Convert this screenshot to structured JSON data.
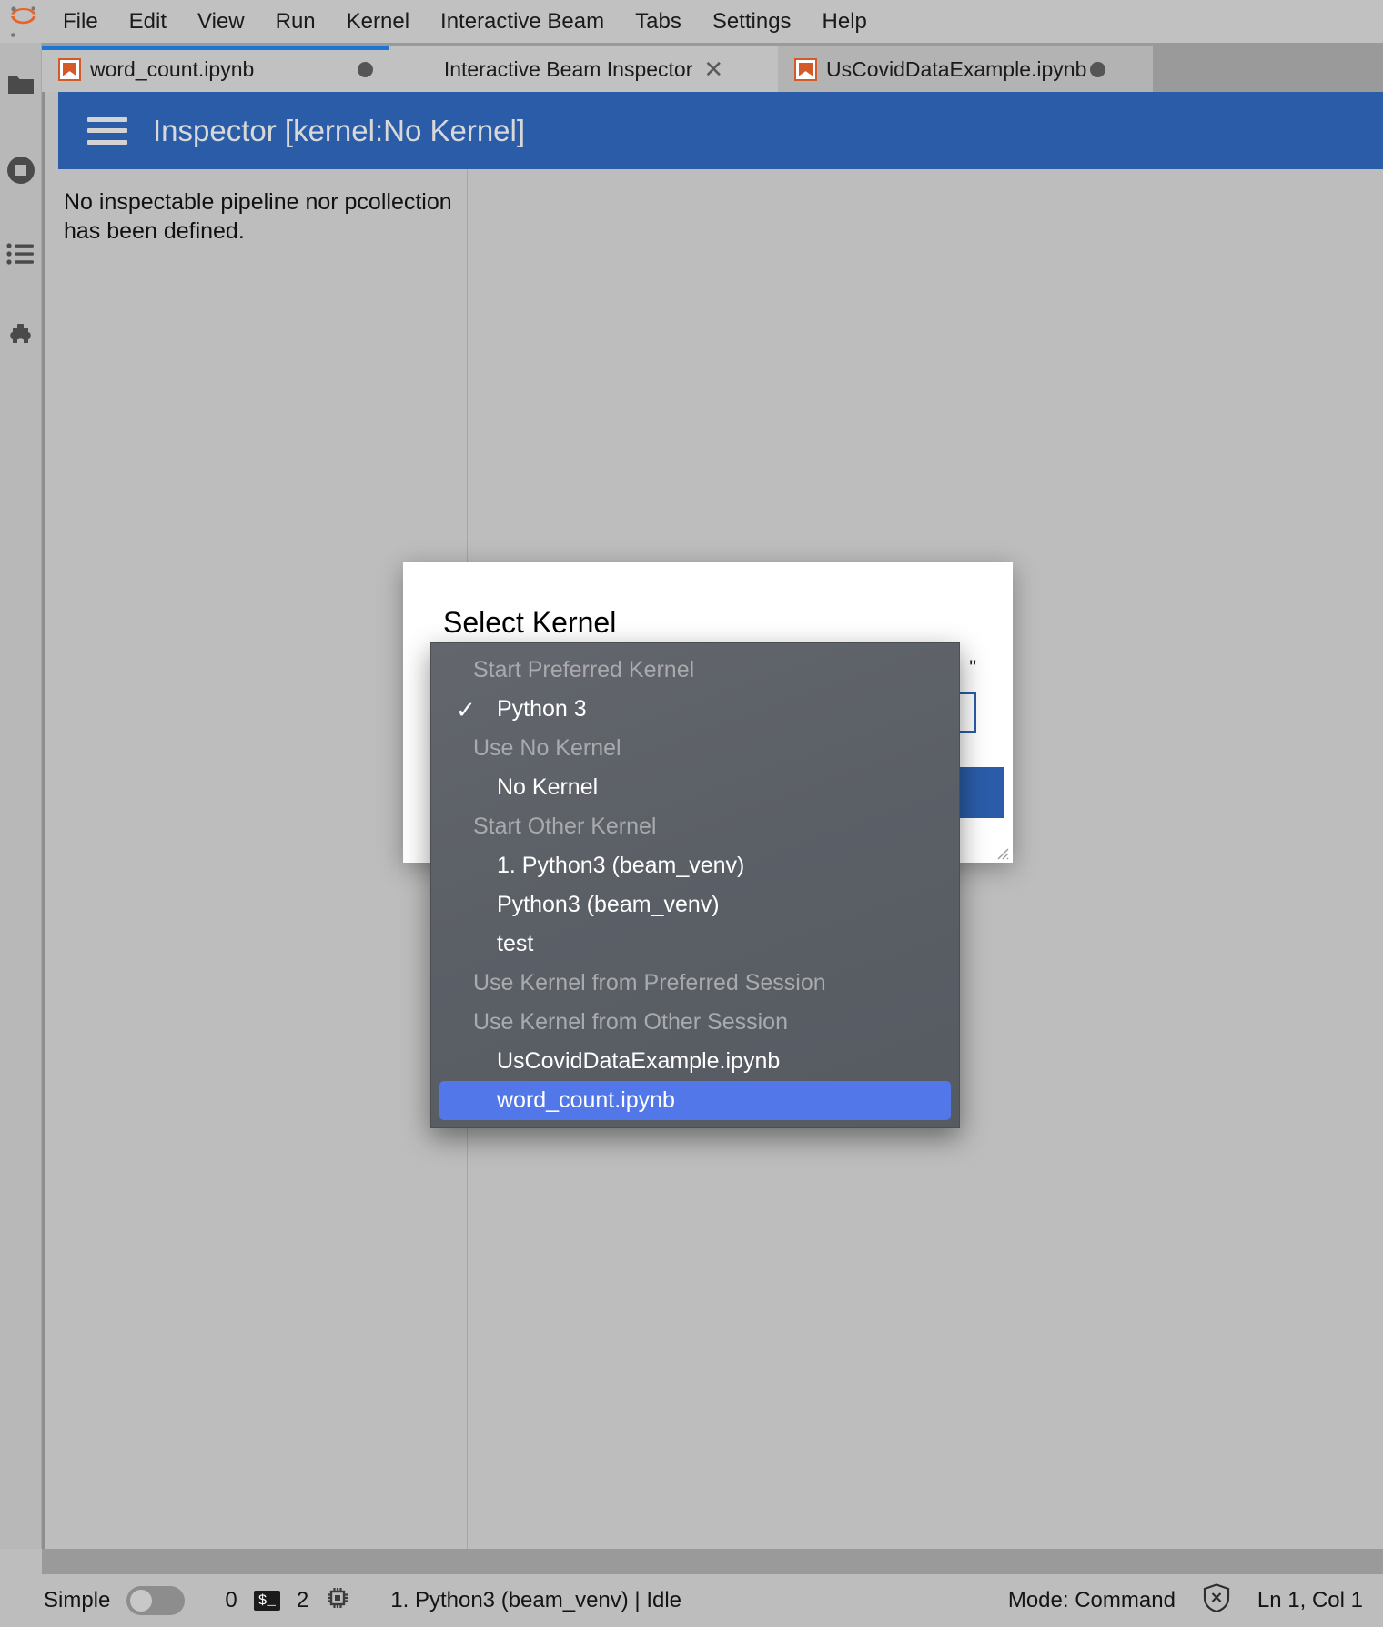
{
  "app": {
    "logo_icon": "jupyter-logo-icon"
  },
  "menubar": {
    "items": [
      {
        "label": "File",
        "name": "menu-file"
      },
      {
        "label": "Edit",
        "name": "menu-edit"
      },
      {
        "label": "View",
        "name": "menu-view"
      },
      {
        "label": "Run",
        "name": "menu-run"
      },
      {
        "label": "Kernel",
        "name": "menu-kernel"
      },
      {
        "label": "Interactive Beam",
        "name": "menu-interactive-beam"
      },
      {
        "label": "Tabs",
        "name": "menu-tabs"
      },
      {
        "label": "Settings",
        "name": "menu-settings"
      },
      {
        "label": "Help",
        "name": "menu-help"
      }
    ]
  },
  "activitybar": {
    "items": [
      {
        "icon": "folder-icon",
        "name": "sidebar-item-file-browser"
      },
      {
        "icon": "running-stop-icon",
        "name": "sidebar-item-running"
      },
      {
        "icon": "command-list-icon",
        "name": "sidebar-item-commands"
      },
      {
        "icon": "puzzle-icon",
        "name": "sidebar-item-extensions"
      }
    ]
  },
  "tabs": [
    {
      "label": "word_count.ipynb",
      "icon": "notebook-icon",
      "dirty": true,
      "closable": false,
      "active_border": true
    },
    {
      "label": "Interactive Beam Inspector",
      "icon": "",
      "dirty": false,
      "closable": true,
      "active_border": false
    },
    {
      "label": "UsCovidDataExample.ipynb",
      "icon": "notebook-icon",
      "dirty": true,
      "closable": false,
      "active_border": false
    }
  ],
  "inspector": {
    "menu_icon": "hamburger-icon",
    "title": "Inspector [kernel:No Kernel]",
    "empty_message": "No inspectable pipeline nor pcollection has been defined.",
    "header_color": "#2a5ca8"
  },
  "dialog": {
    "title": "Select Kernel",
    "hint_fragment": "\"",
    "primary_button": "",
    "resize_handle": "resize-grip-icon"
  },
  "kernel_menu": {
    "entries": [
      {
        "type": "header",
        "label": "Start Preferred Kernel",
        "name": "kernel-group-start-preferred"
      },
      {
        "type": "item",
        "label": "Python 3",
        "checked": true,
        "selected": false,
        "name": "kernel-item-python-3"
      },
      {
        "type": "header",
        "label": "Use No Kernel",
        "name": "kernel-group-use-no-kernel"
      },
      {
        "type": "item",
        "label": "No Kernel",
        "checked": false,
        "selected": false,
        "name": "kernel-item-no-kernel"
      },
      {
        "type": "header",
        "label": "Start Other Kernel",
        "name": "kernel-group-start-other"
      },
      {
        "type": "item",
        "label": "1. Python3 (beam_venv)",
        "checked": false,
        "selected": false,
        "name": "kernel-item-1-python3-beam-venv"
      },
      {
        "type": "item",
        "label": "Python3 (beam_venv)",
        "checked": false,
        "selected": false,
        "name": "kernel-item-python3-beam-venv"
      },
      {
        "type": "item",
        "label": "test",
        "checked": false,
        "selected": false,
        "name": "kernel-item-test"
      },
      {
        "type": "header",
        "label": "Use Kernel from Preferred Session",
        "name": "kernel-group-preferred-session"
      },
      {
        "type": "header",
        "label": "Use Kernel from Other Session",
        "name": "kernel-group-other-session"
      },
      {
        "type": "item",
        "label": "UsCovidDataExample.ipynb",
        "checked": false,
        "selected": false,
        "name": "kernel-item-uscoviddataexample"
      },
      {
        "type": "item",
        "label": "word_count.ipynb",
        "checked": false,
        "selected": true,
        "name": "kernel-item-word-count"
      }
    ],
    "checkmark": "✓",
    "highlight_color": "#5277e8"
  },
  "statusbar": {
    "simple_label": "Simple",
    "simple_toggle_on": false,
    "terminal_count": "0",
    "terminal_icon": "terminal-icon",
    "kernel_count": "2",
    "kernel_icon": "chip-icon",
    "kernel_status": "1. Python3 (beam_venv) | Idle",
    "mode": "Mode: Command",
    "no_conflict_icon": "shield-x-icon",
    "cursor_position": "Ln 1, Col 1"
  }
}
